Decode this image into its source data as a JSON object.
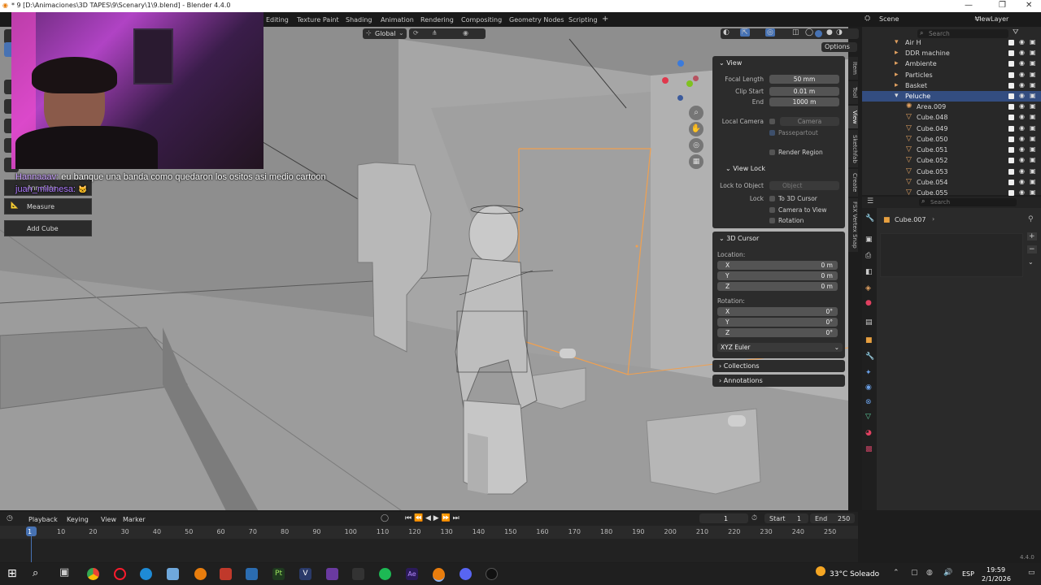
{
  "window": {
    "title": "* 9 [D:\\Animaciones\\3D TAPES\\9\\Scenary\\1\\9.blend] - Blender 4.4.0",
    "minimize": "—",
    "maximize": "❐",
    "close": "✕"
  },
  "workspaces": [
    "Editing",
    "Texture Paint",
    "Shading",
    "Animation",
    "Rendering",
    "Compositing",
    "Geometry Nodes",
    "Scripting"
  ],
  "viewport_header": {
    "transform_orientation": "Global",
    "options_label": "Options"
  },
  "chat": {
    "line1_user": "Hannaaav:",
    "line1_text": "eu banque una banda como quedaron los ositos asi medio cartoon",
    "line2_user": "juan_milanesa:"
  },
  "tools": {
    "annotate": "Annotate",
    "measure": "Measure",
    "add_cube": "Add Cube"
  },
  "npanel": {
    "tabs": [
      "Item",
      "Tool",
      "View",
      "Sketchfab",
      "Create",
      "FSX Vertex Snap"
    ],
    "view": {
      "header": "View",
      "focal_length_label": "Focal Length",
      "focal_length": "50 mm",
      "clip_start_label": "Clip Start",
      "clip_start": "0.01 m",
      "end_label": "End",
      "end": "1000 m",
      "local_camera_label": "Local Camera",
      "local_camera": "Camera",
      "passepartout": "Passepartout",
      "render_region": "Render Region"
    },
    "view_lock": {
      "header": "View Lock",
      "lock_to_object_label": "Lock to Object",
      "lock_to_object": "Object",
      "lock_label": "Lock",
      "to_3d_cursor": "To 3D Cursor",
      "camera_to_view": "Camera to View",
      "rotation": "Rotation"
    },
    "cursor": {
      "header": "3D Cursor",
      "location_label": "Location:",
      "x_label": "X",
      "x": "0 m",
      "y_label": "Y",
      "y": "0 m",
      "z_label": "Z",
      "z": "0 m",
      "rotation_label": "Rotation:",
      "rx_label": "X",
      "rx": "0°",
      "ry_label": "Y",
      "ry": "0°",
      "rz_label": "Z",
      "rz": "0°",
      "mode": "XYZ Euler"
    },
    "collections": "Collections",
    "annotations": "Annotations"
  },
  "top_right": {
    "scene": "Scene",
    "view_layer": "ViewLayer",
    "search_placeholder": "Search"
  },
  "outliner": {
    "items": [
      {
        "name": "Air H"
      },
      {
        "name": "DDR machine"
      },
      {
        "name": "Ambiente"
      },
      {
        "name": "Particles"
      },
      {
        "name": "Basket"
      },
      {
        "name": "Peluche"
      },
      {
        "name": "Area.009"
      },
      {
        "name": "Cube.048"
      },
      {
        "name": "Cube.049"
      },
      {
        "name": "Cube.050"
      },
      {
        "name": "Cube.051"
      },
      {
        "name": "Cube.052"
      },
      {
        "name": "Cube.053"
      },
      {
        "name": "Cube.054"
      },
      {
        "name": "Cube.055"
      }
    ]
  },
  "properties": {
    "search_placeholder": "Search",
    "object": "Cube.007"
  },
  "timeline": {
    "menus": [
      "Playback",
      "Keying",
      "View",
      "Marker"
    ],
    "current_frame": "1",
    "start_label": "Start",
    "start": "1",
    "end_label": "End",
    "end": "250",
    "ticks": [
      "1",
      "10",
      "20",
      "30",
      "40",
      "50",
      "60",
      "70",
      "80",
      "90",
      "100",
      "110",
      "120",
      "130",
      "140",
      "150",
      "160",
      "170",
      "180",
      "190",
      "200",
      "210",
      "220",
      "230",
      "240",
      "250"
    ],
    "version": "4.4.0"
  },
  "taskbar": {
    "weather": "33°C  Soleado",
    "lang": "ESP",
    "time": "19:59",
    "date": "2/1/2026"
  },
  "colors": {
    "accent": "#4772b3",
    "selection": "#f0a050",
    "viewport_bg": "#8e8e8e"
  }
}
